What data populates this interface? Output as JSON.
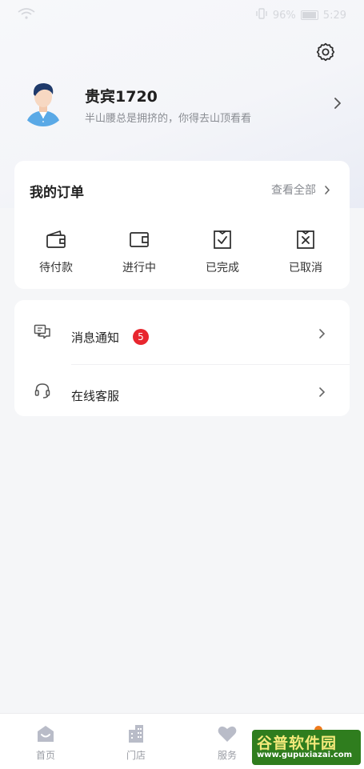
{
  "status_bar": {
    "battery": "96%",
    "time": "5:29"
  },
  "profile": {
    "name": "贵宾1720",
    "bio": "半山腰总是拥挤的，你得去山顶看看"
  },
  "orders": {
    "title": "我的订单",
    "view_all": "查看全部",
    "items": [
      {
        "label": "待付款",
        "icon": "wallet-icon"
      },
      {
        "label": "进行中",
        "icon": "in-progress-icon"
      },
      {
        "label": "已完成",
        "icon": "completed-icon"
      },
      {
        "label": "已取消",
        "icon": "cancelled-icon"
      }
    ]
  },
  "menu": {
    "items": [
      {
        "label": "消息通知",
        "badge": "5",
        "icon": "message-icon"
      },
      {
        "label": "在线客服",
        "icon": "headset-icon"
      }
    ]
  },
  "tabbar": {
    "items": [
      {
        "label": "首页",
        "icon": "home-icon"
      },
      {
        "label": "门店",
        "icon": "store-icon"
      },
      {
        "label": "服务",
        "icon": "heart-icon"
      }
    ]
  },
  "watermark": {
    "title": "谷普软件园",
    "url": "www.gupuxiazai.com"
  },
  "colors": {
    "accent_badge": "#e8262e",
    "tab_dot": "#f07a1d",
    "icon_gray": "#b9bcc8"
  }
}
